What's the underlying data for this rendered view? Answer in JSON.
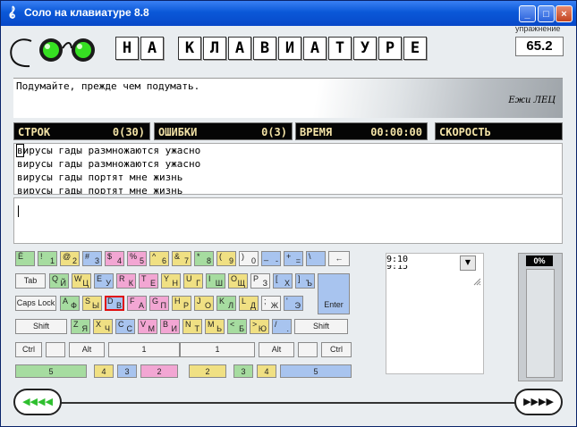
{
  "window": {
    "title": "Соло на клавиатуре 8.8",
    "minimize": "_",
    "maximize": "□",
    "close": "×"
  },
  "header": {
    "letters": [
      "Н",
      "А",
      "",
      "К",
      "Л",
      "А",
      "В",
      "И",
      "А",
      "Т",
      "У",
      "Р",
      "Е"
    ],
    "exercise_label": "упражнение",
    "exercise_value": "65.2"
  },
  "quote": {
    "text": "Подумайте, прежде чем подумать.",
    "author": "Ежи ЛЕЦ"
  },
  "stats": {
    "rows_label": "СТРОК",
    "rows_value": "0(30)",
    "errors_label": "ОШИБКИ",
    "errors_value": "0(3)",
    "time_label": "ВРЕМЯ",
    "time_value": "00:00:00",
    "speed_label": "СКОРОСТЬ"
  },
  "text_lines": [
    "вирусы гады размножаются ужасно",
    "вирусы гады размножаются ужасно",
    "вирусы гады портят мне жизнь",
    "вирусы гады портят мне жизнь"
  ],
  "panel": {
    "line1": "9:10",
    "line2": "9:15",
    "dropdown": "▼"
  },
  "progress": {
    "label": "0%",
    "value": 0
  },
  "nav": {
    "prev": "◀◀◀◀",
    "next": "▶▶▶▶"
  },
  "colors": {
    "green": "#a6dca0",
    "blue": "#a8c4ef",
    "pink": "#f2a6d3",
    "yellow": "#f0e083",
    "highlight": "#e01010"
  },
  "keyboard": {
    "row1": [
      {
        "t": "Ё",
        "b": "",
        "c": "kg"
      },
      {
        "t": "!",
        "b": "1",
        "c": "kg"
      },
      {
        "t": "@",
        "b": "2",
        "c": "ky"
      },
      {
        "t": "#",
        "b": "3",
        "c": "kb"
      },
      {
        "t": "$",
        "b": "4",
        "c": "kp"
      },
      {
        "t": "%",
        "b": "5",
        "c": "kp"
      },
      {
        "t": "^",
        "b": "6",
        "c": "ky"
      },
      {
        "t": "&",
        "b": "7",
        "c": "ky"
      },
      {
        "t": "*",
        "b": "8",
        "c": "kg"
      },
      {
        "t": "(",
        "b": "9",
        "c": "ky"
      },
      {
        "t": ")",
        "b": "0",
        "c": "kw"
      },
      {
        "t": "_",
        "b": "-",
        "c": "kb"
      },
      {
        "t": "+",
        "b": "=",
        "c": "kb"
      },
      {
        "t": "\\",
        "b": "",
        "c": "kb"
      }
    ],
    "row2": [
      {
        "t": "Q",
        "b": "Й",
        "c": "kg"
      },
      {
        "t": "W",
        "b": "Ц",
        "c": "ky"
      },
      {
        "t": "E",
        "b": "У",
        "c": "kb"
      },
      {
        "t": "R",
        "b": "К",
        "c": "kp"
      },
      {
        "t": "T",
        "b": "Е",
        "c": "kp"
      },
      {
        "t": "Y",
        "b": "Н",
        "c": "ky"
      },
      {
        "t": "U",
        "b": "Г",
        "c": "ky"
      },
      {
        "t": "I",
        "b": "Ш",
        "c": "kg"
      },
      {
        "t": "O",
        "b": "Щ",
        "c": "ky"
      },
      {
        "t": "P",
        "b": "З",
        "c": "kw"
      },
      {
        "t": "[",
        "b": "Х",
        "c": "kb"
      },
      {
        "t": "]",
        "b": "Ъ",
        "c": "kb"
      }
    ],
    "row3": [
      {
        "t": "A",
        "b": "Ф",
        "c": "kg"
      },
      {
        "t": "S",
        "b": "Ы",
        "c": "ky"
      },
      {
        "t": "D",
        "b": "В",
        "c": "kb"
      },
      {
        "t": "F",
        "b": "А",
        "c": "kp"
      },
      {
        "t": "G",
        "b": "П",
        "c": "kp"
      },
      {
        "t": "H",
        "b": "Р",
        "c": "ky"
      },
      {
        "t": "J",
        "b": "О",
        "c": "ky"
      },
      {
        "t": "K",
        "b": "Л",
        "c": "kg"
      },
      {
        "t": "L",
        "b": "Д",
        "c": "ky"
      },
      {
        "t": ";",
        "b": "Ж",
        "c": "kw"
      },
      {
        "t": "'",
        "b": "Э",
        "c": "kb"
      }
    ],
    "row4": [
      {
        "t": "Z",
        "b": "Я",
        "c": "kg"
      },
      {
        "t": "X",
        "b": "Ч",
        "c": "ky"
      },
      {
        "t": "C",
        "b": "С",
        "c": "kb"
      },
      {
        "t": "V",
        "b": "М",
        "c": "kp"
      },
      {
        "t": "B",
        "b": "И",
        "c": "kp"
      },
      {
        "t": "N",
        "b": "Т",
        "c": "ky"
      },
      {
        "t": "M",
        "b": "Ь",
        "c": "ky"
      },
      {
        "t": "<",
        "b": "Б",
        "c": "kg"
      },
      {
        "t": ">",
        "b": "Ю",
        "c": "ky"
      },
      {
        "t": "/",
        "b": ".",
        "c": "kb"
      }
    ],
    "tab": "Tab",
    "caps": "Caps Lock",
    "enter": "Enter",
    "shift_l": "Shift",
    "shift_r": "Shift",
    "backspace": "←",
    "ctrl_l": "Ctrl",
    "alt_l": "Alt",
    "alt_r": "Alt",
    "ctrl_r": "Ctrl",
    "space_l": "1",
    "space_r": "1",
    "finger_row": [
      "5",
      "4",
      "3",
      "2",
      "2",
      "3",
      "4",
      "5"
    ]
  }
}
